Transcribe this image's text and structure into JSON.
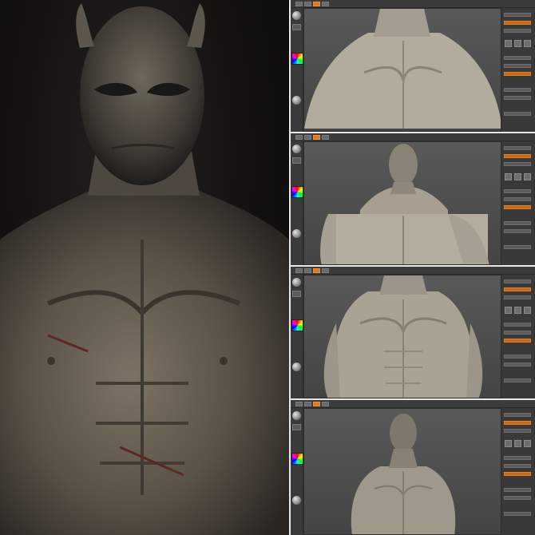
{
  "hero": {
    "subject": "demon-bust-render"
  },
  "panels": [
    {
      "view": "chest-closeup",
      "active_tool": "move"
    },
    {
      "view": "head-and-chest-split",
      "active_tool": "move"
    },
    {
      "view": "torso-full",
      "active_tool": "move"
    },
    {
      "view": "head-and-torso-zoomed-out",
      "active_tool": "move"
    }
  ],
  "colors": {
    "background": "#0d0d0d",
    "ui_panel": "#4a4a4a",
    "accent": "#e07a1e",
    "clay": "#b8b0a0",
    "render_skin": "#6e6558"
  },
  "icons": [
    "sculpt-brush-icon",
    "color-picker-icon",
    "material-sphere-icon"
  ]
}
